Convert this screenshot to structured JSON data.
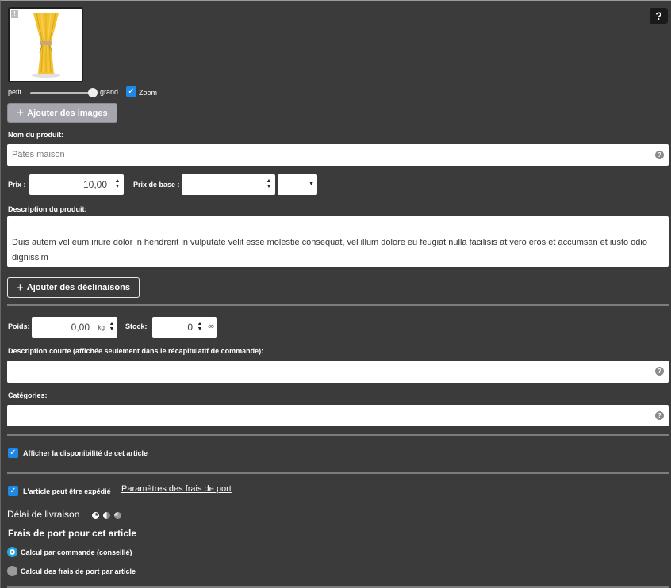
{
  "header": {
    "help_label": "?"
  },
  "image": {
    "badge": "!"
  },
  "size": {
    "small_label": "petit",
    "large_label": "grand",
    "zoom_label": "Zoom"
  },
  "buttons": {
    "add_images": "Ajouter des images",
    "add_variants": "Ajouter des déclinaisons"
  },
  "product": {
    "name_label": "Nom du produit:",
    "name_placeholder": "Pâtes maison",
    "price_label": "Prix :",
    "price_value": "10,00",
    "base_price_label": "Prix de base :",
    "base_price_value": "",
    "unit_select_value": "",
    "description_label": "Description du produit:",
    "description_text": "Duis autem vel eum iriure dolor in hendrerit in vulputate velit esse molestie consequat, vel illum dolore eu feugiat nulla facilisis at vero eros et accumsan et iusto odio dignissim"
  },
  "stock": {
    "weight_label": "Poids:",
    "weight_value": "0,00",
    "weight_unit": "kg",
    "stock_label": "Stock:",
    "stock_value": "0",
    "infinity": "∞"
  },
  "short_description_label": "Description courte (affichée seulement dans le récapitulatif de commande):",
  "categories_label": "Catégories:",
  "availability_label": "Afficher la disponibilité de cet article",
  "shipping": {
    "can_ship_label": "L'article peut être expédié",
    "settings_link": "Paramètres des frais de port",
    "delay_label": "Délai de livraison",
    "fees_heading": "Frais de port pour cet article",
    "option_per_order": "Calcul par commande (conseillé)",
    "option_per_article": "Calcul des frais de port par article"
  },
  "colors": {
    "accent": "#1e88e5",
    "background": "#3b3b3b",
    "pasta": "#f2c230"
  }
}
